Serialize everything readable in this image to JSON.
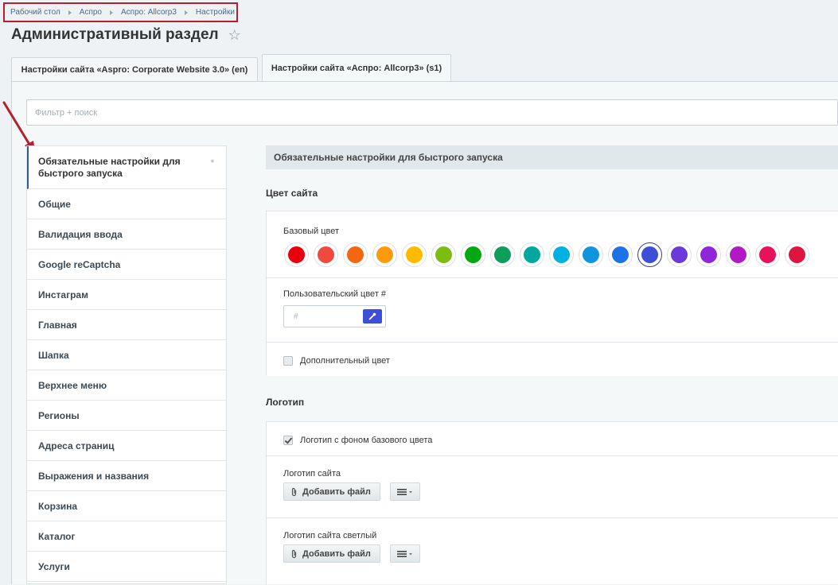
{
  "breadcrumb": [
    "Рабочий стол",
    "Аспро",
    "Аспро: Allcorp3",
    "Настройки"
  ],
  "title": "Административный раздел",
  "tabs": [
    {
      "label": "Настройки сайта «Aspro: Corporate Website 3.0» (en)",
      "active": false
    },
    {
      "label": "Настройки сайта «Аспро: Allcorp3» (s1)",
      "active": true
    }
  ],
  "filter": {
    "placeholder": "Фильтр + поиск"
  },
  "sidebar": {
    "items": [
      "Обязательные настройки для быстрого запуска",
      "Общие",
      "Валидация ввода",
      "Google reCaptcha",
      "Инстаграм",
      "Главная",
      "Шапка",
      "Верхнее меню",
      "Регионы",
      "Адреса страниц",
      "Выражения и названия",
      "Корзина",
      "Каталог",
      "Услуги"
    ]
  },
  "main": {
    "section_header": "Обязательные настройки для быстрого запуска",
    "site_color": {
      "title": "Цвет сайта",
      "base_color_label": "Базовый цвет",
      "swatches": [
        "#e8000d",
        "#f2493f",
        "#f26710",
        "#ff9a0b",
        "#ffb900",
        "#7dbd12",
        "#04a814",
        "#0d9e5c",
        "#00a79d",
        "#00b1e1",
        "#0f95de",
        "#1e72e8",
        "#3d4ed7",
        "#6a3adb",
        "#8f27d8",
        "#b118c6",
        "#e8125c",
        "#de1540"
      ],
      "selected_index": 12,
      "custom_color_label": "Пользовательский цвет #",
      "custom_color_placeholder": "#",
      "additional_color_label": "Дополнительный цвет",
      "additional_color_checked": false
    },
    "logo": {
      "title": "Логотип",
      "bg_checkbox_label": "Логотип с фоном базового цвета",
      "bg_checkbox_checked": true,
      "site_logo_label": "Логотип сайта",
      "site_logo_light_label": "Логотип сайта светлый",
      "add_file_label": "Добавить файл"
    }
  }
}
